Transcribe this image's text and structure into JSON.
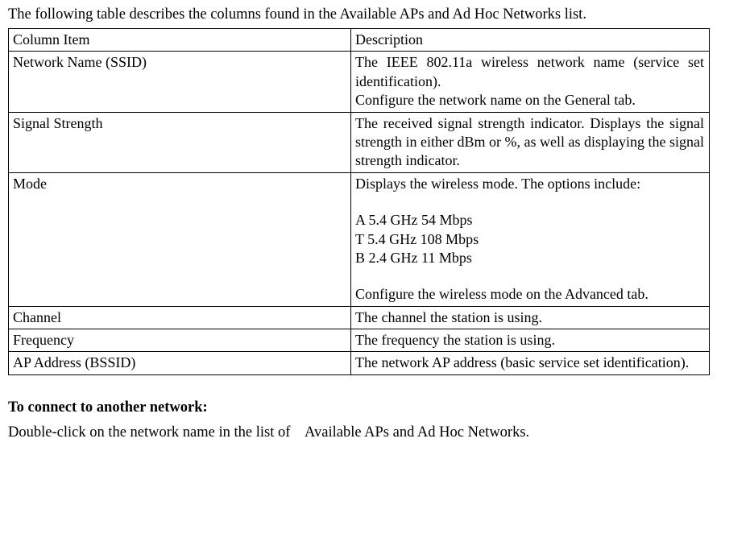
{
  "intro": "The following table describes the columns found in the Available APs and Ad Hoc Networks list.",
  "header": {
    "col1": "Column Item",
    "col2": "Description"
  },
  "rows": {
    "r0": {
      "name": "Network Name (SSID)",
      "desc_line1": "The IEEE 802.11a wireless network name (service set identification).",
      "desc_line2": "Configure the network name on the General tab."
    },
    "r1": {
      "name": "Signal Strength",
      "desc": "The received signal strength indicator. Displays the signal strength in either dBm or %, as well as displaying the signal strength indicator."
    },
    "r2": {
      "name": "Mode",
      "desc_intro": "Displays the wireless mode. The options include:",
      "opt1": "A 5.4 GHz 54 Mbps",
      "opt2": "T 5.4 GHz 108 Mbps",
      "opt3": "B 2.4 GHz 11 Mbps",
      "desc_outro": "Configure the wireless mode on the Advanced tab."
    },
    "r3": {
      "name": "Channel",
      "desc": "The channel the station is using."
    },
    "r4": {
      "name": "Frequency",
      "desc": "The frequency the station is using."
    },
    "r5": {
      "name": "AP Address (BSSID)",
      "desc": "The network AP address (basic service set identification)."
    }
  },
  "heading": "To connect to another network:",
  "instruction_part1": "Double-click on the network name in the list of",
  "instruction_part2": "Available APs and Ad Hoc Networks."
}
